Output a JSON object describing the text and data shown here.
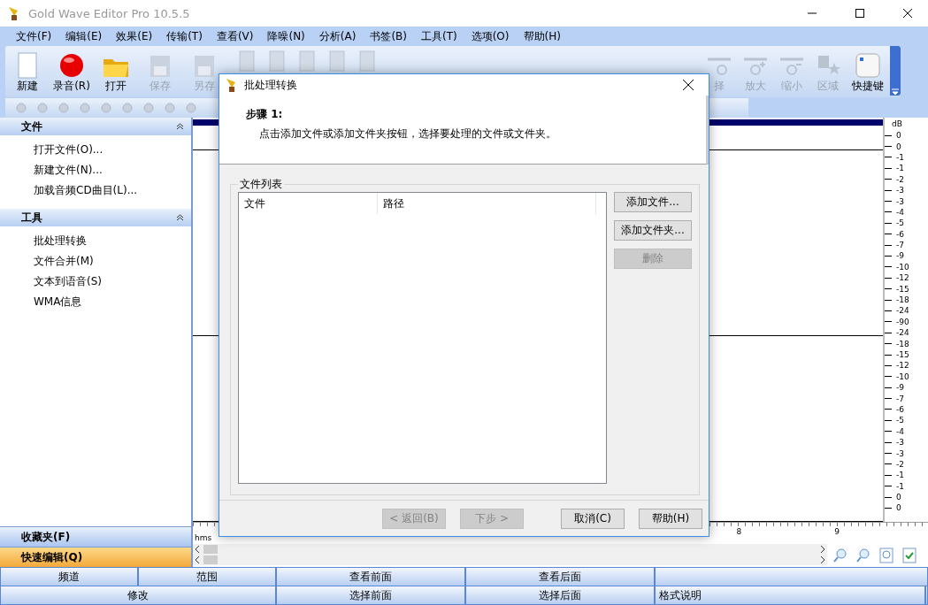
{
  "window": {
    "title": "Gold Wave Editor Pro 10.5.5"
  },
  "menu": [
    "文件(F)",
    "编辑(E)",
    "效果(E)",
    "传输(T)",
    "查看(V)",
    "降噪(N)",
    "分析(A)",
    "书签(B)",
    "工具(T)",
    "选项(O)",
    "帮助(H)"
  ],
  "toolbar": {
    "left": [
      {
        "label": "新建",
        "disabled": false
      },
      {
        "label": "录音(R)",
        "disabled": false
      },
      {
        "label": "打开",
        "disabled": false
      },
      {
        "label": "保存",
        "disabled": true
      },
      {
        "label": "另存",
        "disabled": true
      }
    ],
    "right": [
      {
        "label": "择",
        "disabled": true
      },
      {
        "label": "放大",
        "disabled": true
      },
      {
        "label": "缩小",
        "disabled": true
      },
      {
        "label": "区域",
        "disabled": true
      },
      {
        "label": "快捷键",
        "disabled": false
      }
    ]
  },
  "sidebar": {
    "sections": [
      {
        "title": "文件",
        "expanded": true,
        "items": [
          "打开文件(O)...",
          "新建文件(N)...",
          "加载音频CD曲目(L)..."
        ]
      },
      {
        "title": "工具",
        "expanded": true,
        "items": [
          "批处理转换",
          "文件合并(M)",
          "文本到语音(S)",
          "WMA信息"
        ]
      }
    ],
    "panels": [
      {
        "label": "收藏夹(F)",
        "selected": false
      },
      {
        "label": "快速编辑(Q)",
        "selected": true
      }
    ]
  },
  "waveform": {
    "db_unit": "dB",
    "db_labels": [
      "0",
      "0",
      "-1",
      "-1",
      "-2",
      "-3",
      "-3",
      "-4",
      "-5",
      "-6",
      "-7",
      "-9",
      "-10",
      "-12",
      "-15",
      "-18",
      "-24",
      "-90",
      "-24",
      "-18",
      "-15",
      "-12",
      "-10",
      "-9",
      "-7",
      "-6",
      "-5",
      "-4",
      "-3",
      "-3",
      "-2",
      "-1",
      "-1",
      "0",
      "0"
    ],
    "timeline": {
      "unit": "hms",
      "ticks": [
        "8",
        "9"
      ]
    }
  },
  "dialog": {
    "title": "批处理转换",
    "step": "步骤 1:",
    "instruction": "点击添加文件或添加文件夹按钮，选择要处理的文件或文件夹。",
    "group": "文件列表",
    "columns": [
      "文件",
      "路径"
    ],
    "side_buttons": [
      {
        "label": "添加文件...",
        "disabled": false
      },
      {
        "label": "添加文件夹...",
        "disabled": false
      },
      {
        "label": "删除",
        "disabled": true
      }
    ],
    "footer_buttons": [
      {
        "label": "< 返回(B)",
        "disabled": true
      },
      {
        "label": "下步 >",
        "disabled": true
      },
      {
        "label": "取消(C)",
        "disabled": false
      },
      {
        "label": "帮助(H)",
        "disabled": false
      }
    ]
  },
  "bottom_bar": {
    "row_1": [
      "频道",
      "范围",
      "查看前面",
      "查看后面"
    ],
    "row_2": [
      "修改",
      "选择前面",
      "选择后面",
      "格式说明"
    ]
  }
}
